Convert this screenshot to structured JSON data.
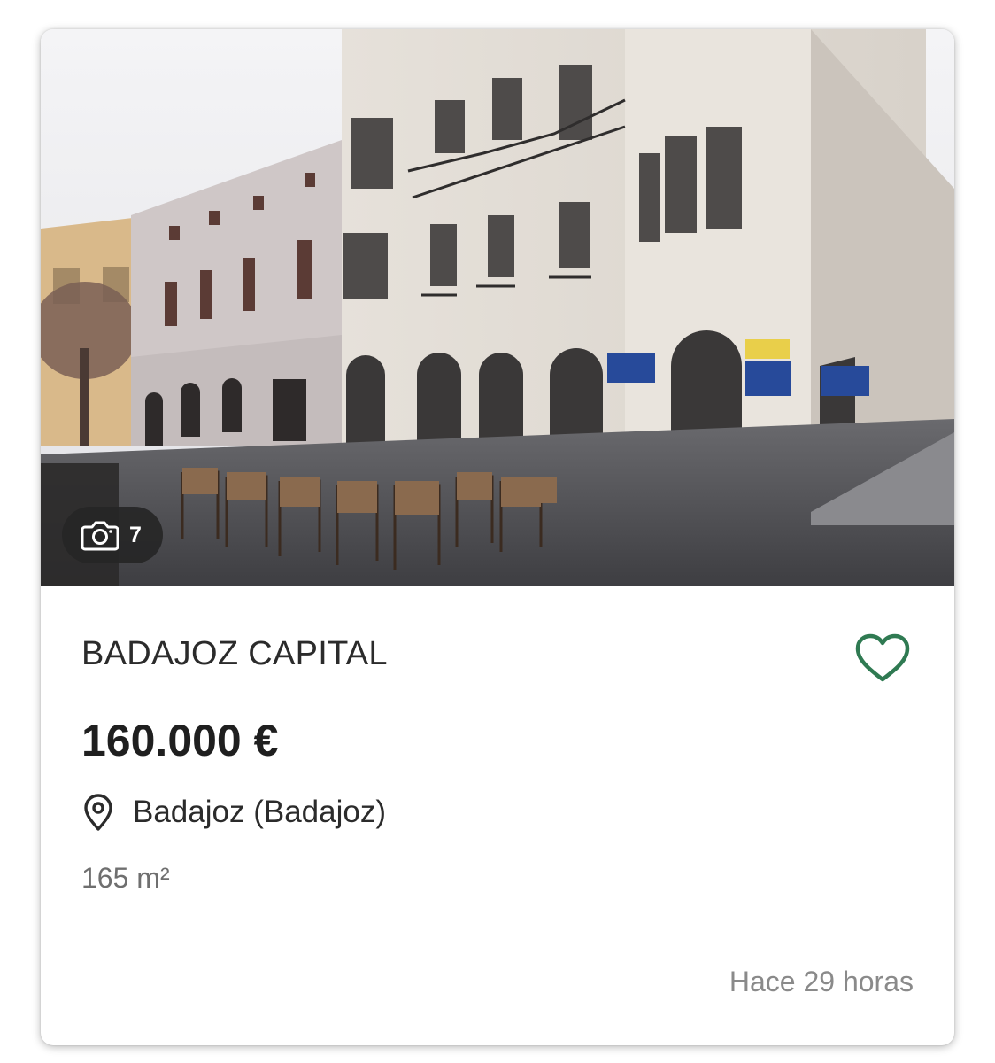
{
  "listing": {
    "title": "BADAJOZ CAPITAL",
    "price": "160.000 €",
    "location": "Badajoz (Badajoz)",
    "area": "165 m²",
    "posted": "Hace 29 horas",
    "photo_count": "7",
    "favorite": false
  },
  "icons": {
    "camera": "camera-icon",
    "favorite": "heart-outline-icon",
    "location": "map-pin-icon"
  },
  "colors": {
    "accent": "#2f7a52",
    "price_text": "#1f1f1f",
    "muted_text": "#8a8a8a"
  }
}
